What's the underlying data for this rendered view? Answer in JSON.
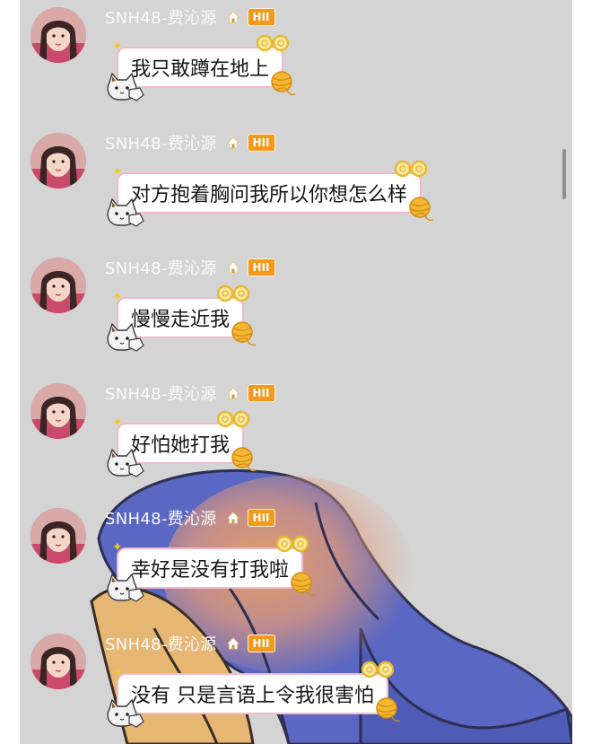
{
  "chat": {
    "messages": [
      {
        "sender": "SNH48-费沁源",
        "level": "HII",
        "text": "我只敢蹲在地上"
      },
      {
        "sender": "SNH48-费沁源",
        "level": "HII",
        "text": "对方抱着胸问我所以你想怎么样"
      },
      {
        "sender": "SNH48-费沁源",
        "level": "HII",
        "text": "慢慢走近我"
      },
      {
        "sender": "SNH48-费沁源",
        "level": "HII",
        "text": "好怕她打我"
      },
      {
        "sender": "SNH48-费沁源",
        "level": "HII",
        "text": "幸好是没有打我啦"
      },
      {
        "sender": "SNH48-费沁源",
        "level": "HII",
        "text": "没有 只是言语上令我很害怕"
      }
    ]
  },
  "colors": {
    "screen_bg": "#d4d4d4",
    "bubble_border": "#f3b8c9",
    "badge": "#f39a1c",
    "sender_text": "#fafafa"
  },
  "icons": {
    "home": "home-icon",
    "cat": "cat-sticker-icon",
    "glasses": "glasses-icon",
    "yarn": "yarn-ball-icon",
    "sparkle": "sparkle-icon"
  }
}
